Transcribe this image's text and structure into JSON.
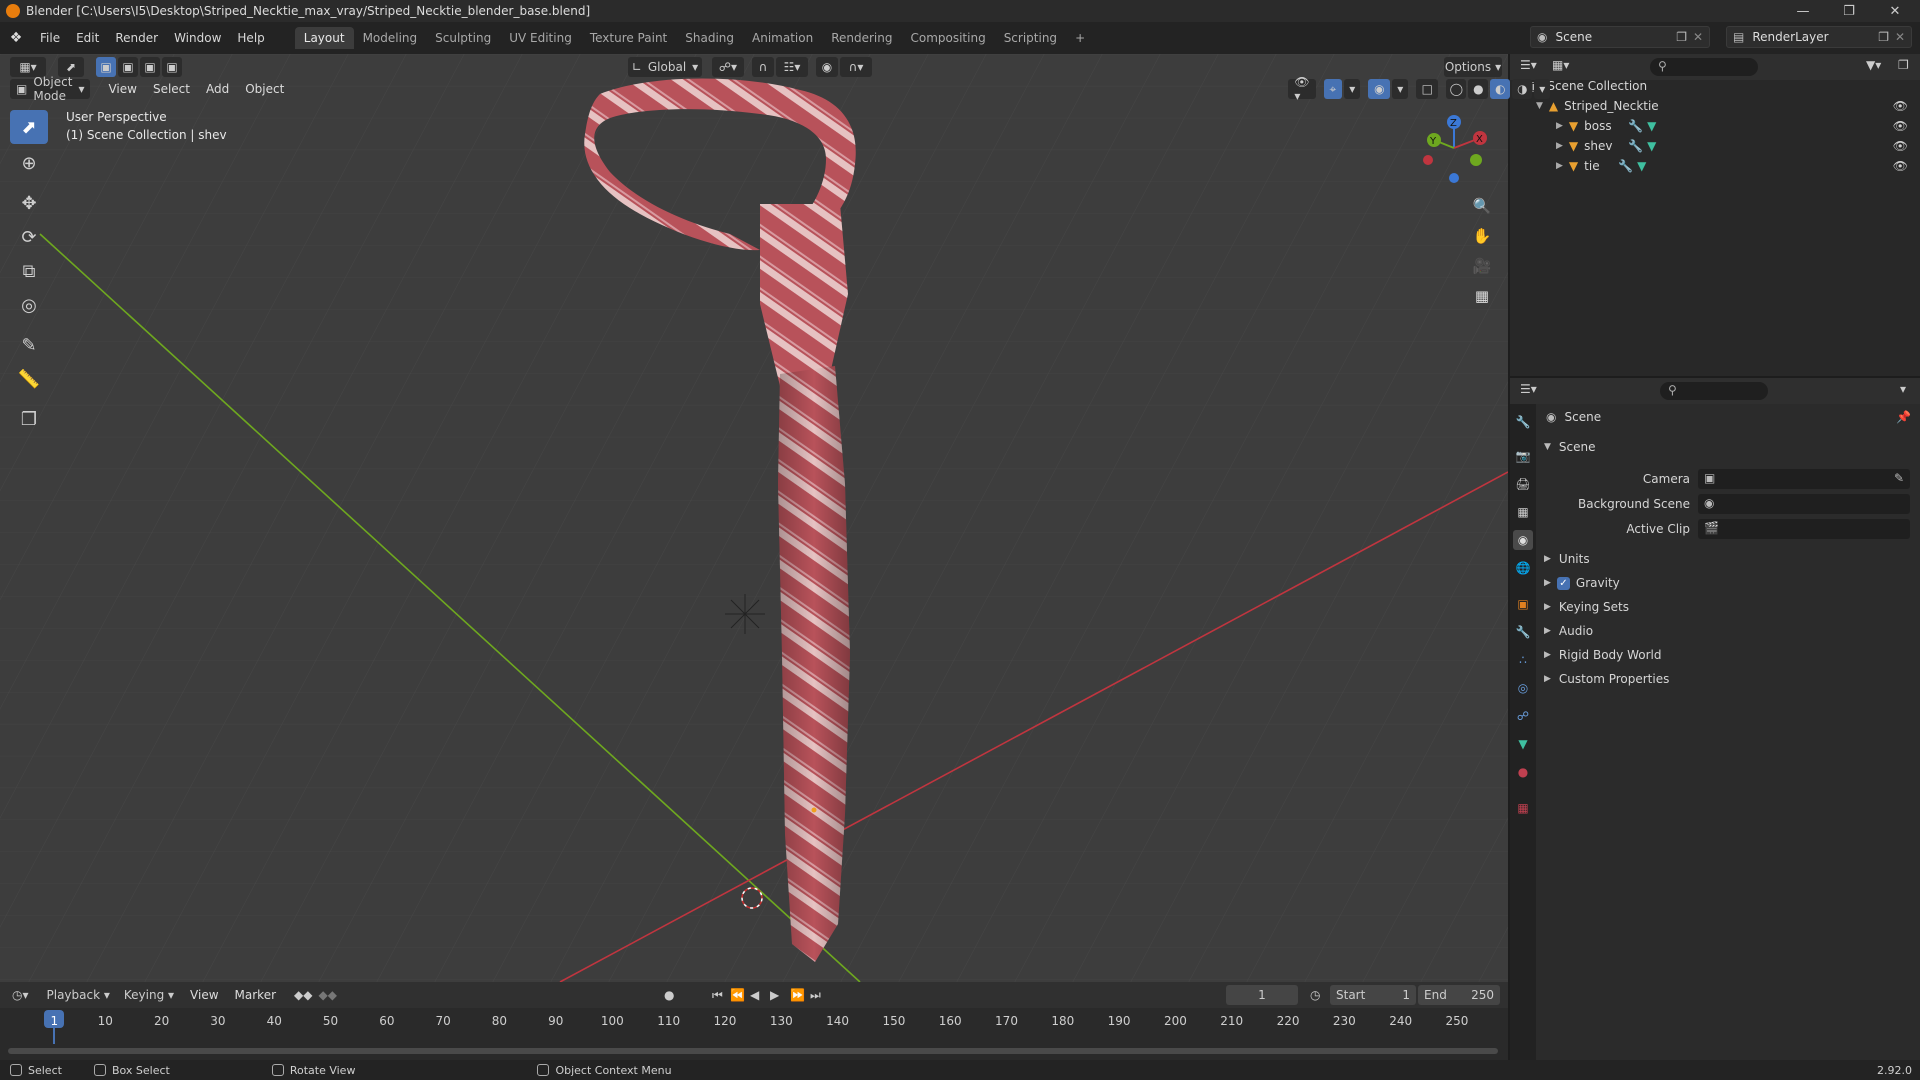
{
  "window": {
    "title": "Blender [C:\\Users\\I5\\Desktop\\Striped_Necktie_max_vray/Striped_Necktie_blender_base.blend]"
  },
  "menu": [
    "File",
    "Edit",
    "Render",
    "Window",
    "Help"
  ],
  "workspaces": [
    "Layout",
    "Modeling",
    "Sculpting",
    "UV Editing",
    "Texture Paint",
    "Shading",
    "Animation",
    "Rendering",
    "Compositing",
    "Scripting"
  ],
  "active_workspace": "Layout",
  "scene_name": "Scene",
  "render_layer": "RenderLayer",
  "viewport": {
    "transform_orientation": "Global",
    "options_label": "Options",
    "mode": "Object Mode",
    "header_menus": [
      "View",
      "Select",
      "Add",
      "Object"
    ],
    "perspective_label": "User Perspective",
    "collection_label": "(1) Scene Collection | shev",
    "gizmo": {
      "x": "X",
      "y": "Y",
      "z": "Z"
    }
  },
  "outliner": {
    "root": "Scene Collection",
    "collection": "Striped_Necktie",
    "objects": [
      "boss",
      "shev",
      "tie"
    ]
  },
  "properties": {
    "context_title": "Scene",
    "panel_title": "Scene",
    "camera_label": "Camera",
    "background_scene_label": "Background Scene",
    "active_clip_label": "Active Clip",
    "subpanels": [
      "Units",
      "Gravity",
      "Keying Sets",
      "Audio",
      "Rigid Body World",
      "Custom Properties"
    ],
    "gravity_checked": true
  },
  "timeline": {
    "menus": [
      "Playback",
      "Keying",
      "View",
      "Marker"
    ],
    "current_frame": "1",
    "start_label": "Start",
    "start_value": "1",
    "end_label": "End",
    "end_value": "250",
    "ticks": [
      "1",
      "10",
      "20",
      "30",
      "40",
      "50",
      "60",
      "70",
      "80",
      "90",
      "100",
      "110",
      "120",
      "130",
      "140",
      "150",
      "160",
      "170",
      "180",
      "190",
      "200",
      "210",
      "220",
      "230",
      "240",
      "250"
    ]
  },
  "statusbar": {
    "select": "Select",
    "box_select": "Box Select",
    "rotate_view": "Rotate View",
    "context_menu": "Object Context Menu",
    "version": "2.92.0"
  },
  "colors": {
    "accent": "#4772b3",
    "viewport_bg": "#3d3d3d",
    "x_axis": "#c0353f",
    "y_axis": "#6ea81f",
    "tie_base": "#b8525a",
    "tie_stripe": "#e6c2c2"
  }
}
